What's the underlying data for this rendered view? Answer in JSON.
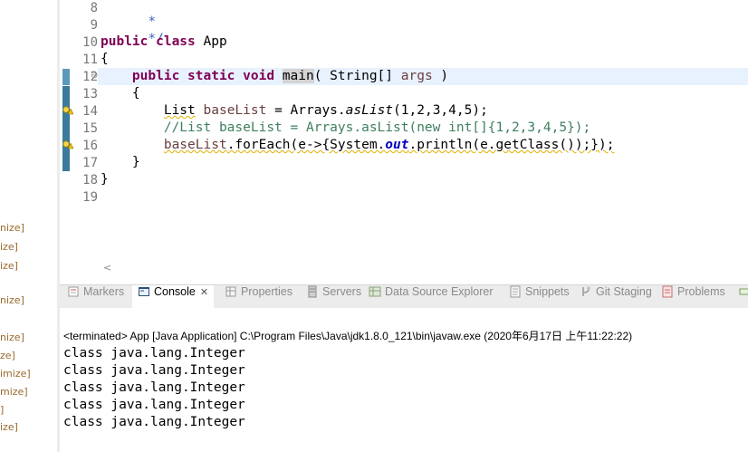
{
  "sidebar": {
    "items": [
      "nize]",
      "ize]",
      "ize]",
      "nize]",
      "nize]",
      "ze]",
      "imize]",
      "mize]",
      "]",
      "ize]"
    ]
  },
  "editor": {
    "line_numbers": [
      "8",
      "9",
      "10",
      "11",
      "12",
      "13",
      "14",
      "15",
      "16",
      "17",
      "18",
      "19"
    ],
    "fold_marker": "⊖",
    "code": {
      "l8": "*",
      "l9": "*/",
      "l10_kw": "public class",
      "l10_name": " App",
      "l11": "{",
      "l12_indent": "    ",
      "l12_kw": "public static void",
      "l12_sp": " ",
      "l12_method": "main",
      "l12_rest1": "( String[] ",
      "l12_param": "args",
      "l12_rest2": " )",
      "l13": "    {",
      "l14_indent": "        ",
      "l14_type": "List",
      "l14_sp": " ",
      "l14_var": "baseList",
      "l14_mid": " = Arrays.",
      "l14_it": "asList",
      "l14_rest": "(1,2,3,4,5);",
      "l15_indent": "        ",
      "l15_comment": "//List baseList = Arrays.asList(new int[]{1,2,3,4,5});",
      "l16_indent": "        ",
      "l16_var": "baseList",
      "l16_mid": ".forEach(e->{System.",
      "l16_field": "out",
      "l16_rest": ".println(e.getClass());});",
      "l17": "    }",
      "l18": "}",
      "l19": ""
    }
  },
  "hscroll": {
    "arrow": "<"
  },
  "tabs": [
    {
      "label": "Markers",
      "icon": "markers-icon",
      "active": false
    },
    {
      "label": "Console",
      "icon": "console-icon",
      "active": true,
      "close": "✕"
    },
    {
      "label": "Properties",
      "icon": "properties-icon",
      "active": false
    },
    {
      "label": "Servers",
      "icon": "servers-icon",
      "active": false
    },
    {
      "label": "Data Source Explorer",
      "icon": "data-source-icon",
      "active": false
    },
    {
      "label": "Snippets",
      "icon": "snippets-icon",
      "active": false
    },
    {
      "label": "Git Staging",
      "icon": "git-staging-icon",
      "active": false
    },
    {
      "label": "Problems",
      "icon": "problems-icon",
      "active": false
    }
  ],
  "console": {
    "status": "<terminated> App [Java Application] C:\\Program Files\\Java\\jdk1.8.0_121\\bin\\javaw.exe (2020年6月17日 上午11:22:22)",
    "output": [
      "class java.lang.Integer",
      "class java.lang.Integer",
      "class java.lang.Integer",
      "class java.lang.Integer",
      "class java.lang.Integer"
    ]
  },
  "colors": {
    "keyword": "#7f0055",
    "comment": "#3f7f5f",
    "javadoc": "#3f5fbf",
    "field": "#0000c0",
    "ruler": "#3a7b9c",
    "current_line": "#e8f2fe"
  }
}
